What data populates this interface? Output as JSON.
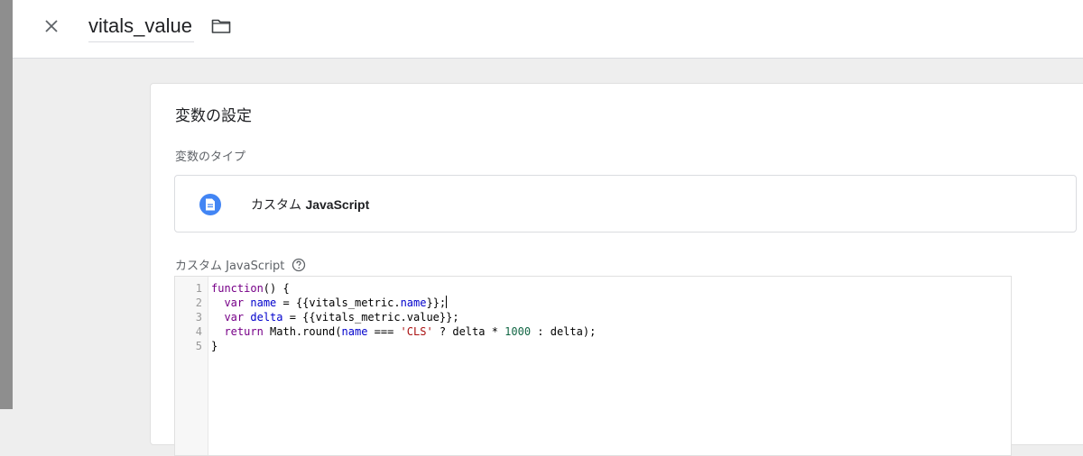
{
  "header": {
    "title": "vitals_value",
    "close_icon": "close-icon",
    "folder_icon": "folder-icon"
  },
  "card": {
    "section_title": "変数の設定",
    "type_label": "変数のタイプ",
    "type": {
      "name_prefix": "カスタム",
      "name_en": "JavaScript",
      "icon": "document-icon",
      "icon_color": "#4285f4"
    },
    "js_label": "カスタム JavaScript",
    "help_icon": "help-icon"
  },
  "editor": {
    "line_numbers": [
      "1",
      "2",
      "3",
      "4",
      "5"
    ],
    "lines": {
      "l1": {
        "a": "function",
        "b": "() {"
      },
      "l2": {
        "a": "var",
        "b": "name",
        "c": " = {{vitals_metric.",
        "d": "name",
        "e": "}};"
      },
      "l3": {
        "a": "var",
        "b": "delta",
        "c": " = {{vitals_metric.value}};"
      },
      "l4": {
        "a": "return",
        "b": " Math.round(",
        "c": "name",
        "d": " === ",
        "e": "'CLS'",
        "f": " ? delta * ",
        "g": "1000",
        "h": " : delta);"
      },
      "l5": {
        "a": "}"
      }
    }
  }
}
